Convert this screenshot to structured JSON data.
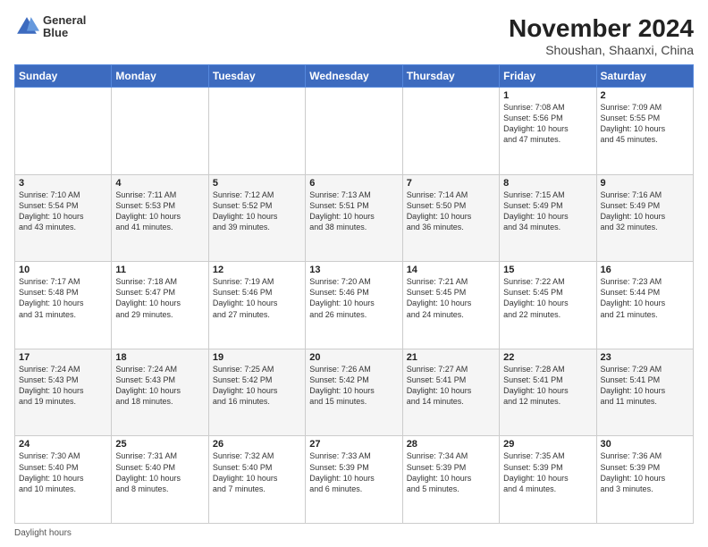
{
  "header": {
    "logo_line1": "General",
    "logo_line2": "Blue",
    "title": "November 2024",
    "subtitle": "Shoushan, Shaanxi, China"
  },
  "weekdays": [
    "Sunday",
    "Monday",
    "Tuesday",
    "Wednesday",
    "Thursday",
    "Friday",
    "Saturday"
  ],
  "footer": "Daylight hours",
  "weeks": [
    [
      {
        "day": "",
        "info": ""
      },
      {
        "day": "",
        "info": ""
      },
      {
        "day": "",
        "info": ""
      },
      {
        "day": "",
        "info": ""
      },
      {
        "day": "",
        "info": ""
      },
      {
        "day": "1",
        "info": "Sunrise: 7:08 AM\nSunset: 5:56 PM\nDaylight: 10 hours\nand 47 minutes."
      },
      {
        "day": "2",
        "info": "Sunrise: 7:09 AM\nSunset: 5:55 PM\nDaylight: 10 hours\nand 45 minutes."
      }
    ],
    [
      {
        "day": "3",
        "info": "Sunrise: 7:10 AM\nSunset: 5:54 PM\nDaylight: 10 hours\nand 43 minutes."
      },
      {
        "day": "4",
        "info": "Sunrise: 7:11 AM\nSunset: 5:53 PM\nDaylight: 10 hours\nand 41 minutes."
      },
      {
        "day": "5",
        "info": "Sunrise: 7:12 AM\nSunset: 5:52 PM\nDaylight: 10 hours\nand 39 minutes."
      },
      {
        "day": "6",
        "info": "Sunrise: 7:13 AM\nSunset: 5:51 PM\nDaylight: 10 hours\nand 38 minutes."
      },
      {
        "day": "7",
        "info": "Sunrise: 7:14 AM\nSunset: 5:50 PM\nDaylight: 10 hours\nand 36 minutes."
      },
      {
        "day": "8",
        "info": "Sunrise: 7:15 AM\nSunset: 5:49 PM\nDaylight: 10 hours\nand 34 minutes."
      },
      {
        "day": "9",
        "info": "Sunrise: 7:16 AM\nSunset: 5:49 PM\nDaylight: 10 hours\nand 32 minutes."
      }
    ],
    [
      {
        "day": "10",
        "info": "Sunrise: 7:17 AM\nSunset: 5:48 PM\nDaylight: 10 hours\nand 31 minutes."
      },
      {
        "day": "11",
        "info": "Sunrise: 7:18 AM\nSunset: 5:47 PM\nDaylight: 10 hours\nand 29 minutes."
      },
      {
        "day": "12",
        "info": "Sunrise: 7:19 AM\nSunset: 5:46 PM\nDaylight: 10 hours\nand 27 minutes."
      },
      {
        "day": "13",
        "info": "Sunrise: 7:20 AM\nSunset: 5:46 PM\nDaylight: 10 hours\nand 26 minutes."
      },
      {
        "day": "14",
        "info": "Sunrise: 7:21 AM\nSunset: 5:45 PM\nDaylight: 10 hours\nand 24 minutes."
      },
      {
        "day": "15",
        "info": "Sunrise: 7:22 AM\nSunset: 5:45 PM\nDaylight: 10 hours\nand 22 minutes."
      },
      {
        "day": "16",
        "info": "Sunrise: 7:23 AM\nSunset: 5:44 PM\nDaylight: 10 hours\nand 21 minutes."
      }
    ],
    [
      {
        "day": "17",
        "info": "Sunrise: 7:24 AM\nSunset: 5:43 PM\nDaylight: 10 hours\nand 19 minutes."
      },
      {
        "day": "18",
        "info": "Sunrise: 7:24 AM\nSunset: 5:43 PM\nDaylight: 10 hours\nand 18 minutes."
      },
      {
        "day": "19",
        "info": "Sunrise: 7:25 AM\nSunset: 5:42 PM\nDaylight: 10 hours\nand 16 minutes."
      },
      {
        "day": "20",
        "info": "Sunrise: 7:26 AM\nSunset: 5:42 PM\nDaylight: 10 hours\nand 15 minutes."
      },
      {
        "day": "21",
        "info": "Sunrise: 7:27 AM\nSunset: 5:41 PM\nDaylight: 10 hours\nand 14 minutes."
      },
      {
        "day": "22",
        "info": "Sunrise: 7:28 AM\nSunset: 5:41 PM\nDaylight: 10 hours\nand 12 minutes."
      },
      {
        "day": "23",
        "info": "Sunrise: 7:29 AM\nSunset: 5:41 PM\nDaylight: 10 hours\nand 11 minutes."
      }
    ],
    [
      {
        "day": "24",
        "info": "Sunrise: 7:30 AM\nSunset: 5:40 PM\nDaylight: 10 hours\nand 10 minutes."
      },
      {
        "day": "25",
        "info": "Sunrise: 7:31 AM\nSunset: 5:40 PM\nDaylight: 10 hours\nand 8 minutes."
      },
      {
        "day": "26",
        "info": "Sunrise: 7:32 AM\nSunset: 5:40 PM\nDaylight: 10 hours\nand 7 minutes."
      },
      {
        "day": "27",
        "info": "Sunrise: 7:33 AM\nSunset: 5:39 PM\nDaylight: 10 hours\nand 6 minutes."
      },
      {
        "day": "28",
        "info": "Sunrise: 7:34 AM\nSunset: 5:39 PM\nDaylight: 10 hours\nand 5 minutes."
      },
      {
        "day": "29",
        "info": "Sunrise: 7:35 AM\nSunset: 5:39 PM\nDaylight: 10 hours\nand 4 minutes."
      },
      {
        "day": "30",
        "info": "Sunrise: 7:36 AM\nSunset: 5:39 PM\nDaylight: 10 hours\nand 3 minutes."
      }
    ]
  ]
}
